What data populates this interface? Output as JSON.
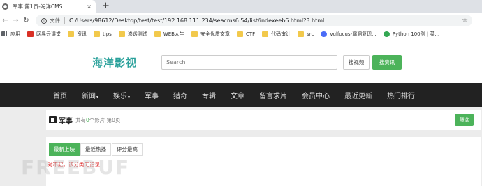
{
  "browser": {
    "tab_title": "军事 第1页-海洋CMS",
    "tab_close": "×",
    "new_tab": "+",
    "url_scheme_label": "文件",
    "url": "C:/Users/98612/Desktop/test/test/192.168.111.234/seacms6.54/list/indexeeb6.html?3.html",
    "bookmarks": [
      {
        "label": "应用",
        "icon": "apps-icon"
      },
      {
        "label": "网易云课堂",
        "icon": "red-icon"
      },
      {
        "label": "资讯",
        "icon": "folder-icon"
      },
      {
        "label": "tips",
        "icon": "folder-icon"
      },
      {
        "label": "渗透测试",
        "icon": "folder-icon"
      },
      {
        "label": "WEB大牛",
        "icon": "folder-icon"
      },
      {
        "label": "安全优质文章",
        "icon": "folder-icon"
      },
      {
        "label": "CTF",
        "icon": "folder-icon"
      },
      {
        "label": "代码审计",
        "icon": "folder-icon"
      },
      {
        "label": "src",
        "icon": "folder-icon"
      },
      {
        "label": "vulfocus-漏洞复现...",
        "icon": "blue-icon"
      },
      {
        "label": "Python 100例 | 菜...",
        "icon": "green-icon"
      }
    ]
  },
  "site": {
    "logo": "海洋影视",
    "search_placeholder": "Search",
    "search_video_label": "搜视频",
    "search_news_label": "搜资讯",
    "nav": [
      {
        "label": "首页",
        "dropdown": false
      },
      {
        "label": "新闻",
        "dropdown": true
      },
      {
        "label": "娱乐",
        "dropdown": true
      },
      {
        "label": "军事",
        "dropdown": false
      },
      {
        "label": "猎奇",
        "dropdown": false
      },
      {
        "label": "专辑",
        "dropdown": false
      },
      {
        "label": "文章",
        "dropdown": false
      },
      {
        "label": "留言求片",
        "dropdown": false
      },
      {
        "label": "会员中心",
        "dropdown": false
      },
      {
        "label": "最近更新",
        "dropdown": false
      },
      {
        "label": "热门排行",
        "dropdown": false
      }
    ],
    "category": {
      "title": "军事",
      "sub_prefix": "共有",
      "count": "0",
      "sub_suffix": "个影片 第0页",
      "filter_label": "筛选"
    },
    "sort_tabs": [
      {
        "label": "最新上映",
        "active": true
      },
      {
        "label": "最近热播",
        "active": false
      },
      {
        "label": "评分最高",
        "active": false
      }
    ],
    "empty_message": "对不起，该分类无记录"
  },
  "colors": {
    "accent": "#4cb35a",
    "logo": "#2aa19b",
    "nav_bg": "#222222",
    "error": "#e03b3b"
  }
}
